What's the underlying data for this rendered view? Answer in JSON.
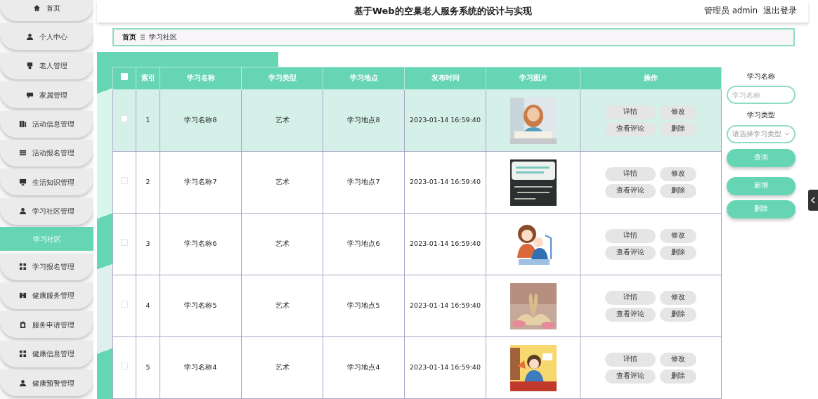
{
  "header": {
    "title": "基于Web的空巢老人服务系统的设计与实现",
    "user": "管理员 admin",
    "logout": "退出登录"
  },
  "sidebar": {
    "items": [
      {
        "label": "首页",
        "kind": "menu",
        "selected": false
      },
      {
        "label": "个人中心",
        "kind": "menu",
        "selected": false
      },
      {
        "label": "老人管理",
        "kind": "menu",
        "selected": false
      },
      {
        "label": "家属管理",
        "kind": "menu",
        "selected": false
      },
      {
        "label": "活动信息管理",
        "kind": "menu",
        "selected": false
      },
      {
        "label": "活动报名管理",
        "kind": "menu",
        "selected": false
      },
      {
        "label": "生活知识管理",
        "kind": "menu",
        "selected": false
      },
      {
        "label": "学习社区管理",
        "kind": "menu",
        "selected": false
      },
      {
        "label": "学习社区",
        "kind": "sub",
        "selected": true
      },
      {
        "label": "学习报名管理",
        "kind": "menu",
        "selected": false
      },
      {
        "label": "健康服务管理",
        "kind": "menu",
        "selected": false
      },
      {
        "label": "服务申请管理",
        "kind": "menu",
        "selected": false
      },
      {
        "label": "健康信息管理",
        "kind": "menu",
        "selected": false
      },
      {
        "label": "健康预警管理",
        "kind": "menu",
        "selected": false
      }
    ]
  },
  "breadcrumb": [
    "首页",
    "学习社区"
  ],
  "table": {
    "header_checked": false,
    "columns": [
      "索引",
      "学习名称",
      "学习类型",
      "学习地点",
      "发布时间",
      "学习图片",
      "操作"
    ],
    "rows": [
      {
        "checked": false,
        "hovered": true,
        "index": "1",
        "name": "学习名称8",
        "type": "艺术",
        "place": "学习地点8",
        "time": "2023-01-14 16:59:40",
        "image": {
          "kind": "picture"
        },
        "actions": [
          "详情",
          "修改",
          "查看评论",
          "删除"
        ]
      },
      {
        "checked": false,
        "hovered": false,
        "index": "2",
        "name": "学习名称7",
        "type": "艺术",
        "place": "学习地点7",
        "time": "2023-01-14 16:59:40",
        "image": {
          "kind": "picture"
        },
        "actions": [
          "详情",
          "修改",
          "查看评论",
          "删除"
        ]
      },
      {
        "checked": false,
        "hovered": false,
        "index": "3",
        "name": "学习名称6",
        "type": "艺术",
        "place": "学习地点6",
        "time": "2023-01-14 16:59:40",
        "image": {
          "kind": "picture"
        },
        "actions": [
          "详情",
          "修改",
          "查看评论",
          "删除"
        ]
      },
      {
        "checked": false,
        "hovered": false,
        "index": "4",
        "name": "学习名称5",
        "type": "艺术",
        "place": "学习地点5",
        "time": "2023-01-14 16:59:40",
        "image": {
          "kind": "picture"
        },
        "actions": [
          "详情",
          "修改",
          "查看评论",
          "删除"
        ]
      },
      {
        "checked": false,
        "hovered": false,
        "index": "5",
        "name": "学习名称4",
        "type": "艺术",
        "place": "学习地点4",
        "time": "2023-01-14 16:59:40",
        "image": {
          "kind": "picture"
        },
        "actions": [
          "详情",
          "修改",
          "查看评论",
          "删除"
        ]
      }
    ]
  },
  "search": {
    "fields": [
      {
        "label": "学习名称",
        "placeholder": "学习名称",
        "kind": "text"
      },
      {
        "label": "学习类型",
        "placeholder": "请选择学习类型",
        "kind": "select"
      }
    ],
    "buttons": [
      "查询",
      "新增",
      "删除"
    ]
  }
}
